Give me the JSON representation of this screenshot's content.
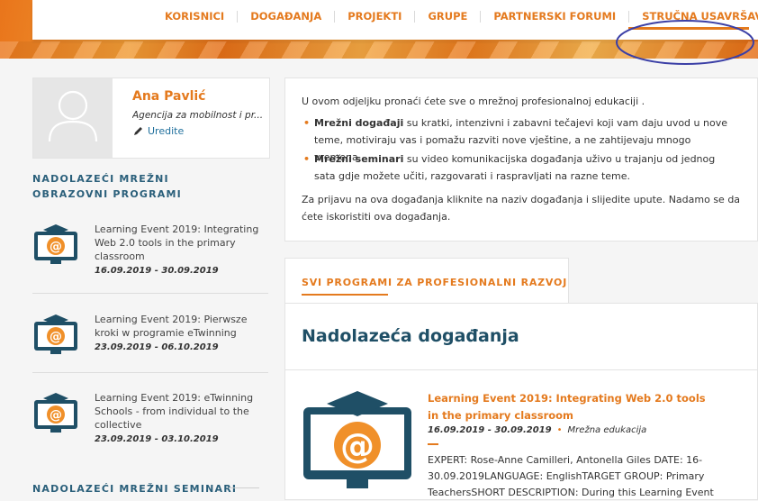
{
  "nav": {
    "items": [
      {
        "label": "KORISNICI"
      },
      {
        "label": "DOGAĐANJA"
      },
      {
        "label": "PROJEKTI"
      },
      {
        "label": "GRUPE"
      },
      {
        "label": "PARTNERSKI FORUMI"
      },
      {
        "label": "STRUČNA USAVRŠAVANJA"
      }
    ],
    "active_index": 5
  },
  "profile": {
    "name": "Ana Pavlić",
    "org": "Agencija za mobilnost i pr...",
    "edit_label": "Uredite"
  },
  "sidebar": {
    "upcoming_programs_title": "NADOLAZEĆI MREŽNI OBRAZOVNI PROGRAMI",
    "events": [
      {
        "title": "Learning Event 2019: Integrating Web 2.0 tools in the primary classroom",
        "dates": "16.09.2019 - 30.09.2019"
      },
      {
        "title": "Learning Event 2019: Pierwsze kroki w programie eTwinning",
        "dates": "23.09.2019 - 06.10.2019"
      },
      {
        "title": "Learning Event 2019: eTwinning Schools - from individual to the collective",
        "dates": "23.09.2019 - 03.10.2019"
      }
    ],
    "upcoming_seminars_title": "NADOLAZEĆI MREŽNI SEMINARI"
  },
  "intro": {
    "lead": "U ovom odjeljku pronaći ćete sve o mrežnoj profesionalnoj edukaciji .",
    "bullets": [
      {
        "bold": "Mrežni događaji",
        "text": " su kratki, intenzivni i zabavni tečajevi koji vam daju uvod u nove teme, motiviraju vas i pomažu razviti nove vještine, a ne zahtijevaju mnogo vremena."
      },
      {
        "bold": "Mrežni seminari",
        "text": " su video komunikacijska događanja uživo u trajanju od jednog sata gdje možete učiti, razgovarati i raspravljati na razne teme."
      }
    ],
    "outro": "Za prijavu na ova događanja kliknite na naziv događanja i slijedite upute. Nadamo se da ćete iskoristiti ova događanja."
  },
  "tabs": {
    "active_label": "SVI PROGRAMI ZA PROFESIONALNI RAZVOJ"
  },
  "main": {
    "heading": "Nadolazeća događanja",
    "item": {
      "title": "Learning Event 2019: Integrating Web 2.0 tools in the primary classroom",
      "dates": "16.09.2019 - 30.09.2019",
      "type": "Mrežna edukacija",
      "description": "EXPERT: Rose-Anne Camilleri, Antonella Giles DATE: 16-30.09.2019LANGUAGE: EnglishTARGET GROUP: Primary TeachersSHORT DESCRIPTION: During this Learning Event"
    }
  },
  "colors": {
    "accent": "#e47a1e",
    "heading": "#1f4f66",
    "link": "#1f6f9c",
    "annotation": "#3b3fa6"
  }
}
